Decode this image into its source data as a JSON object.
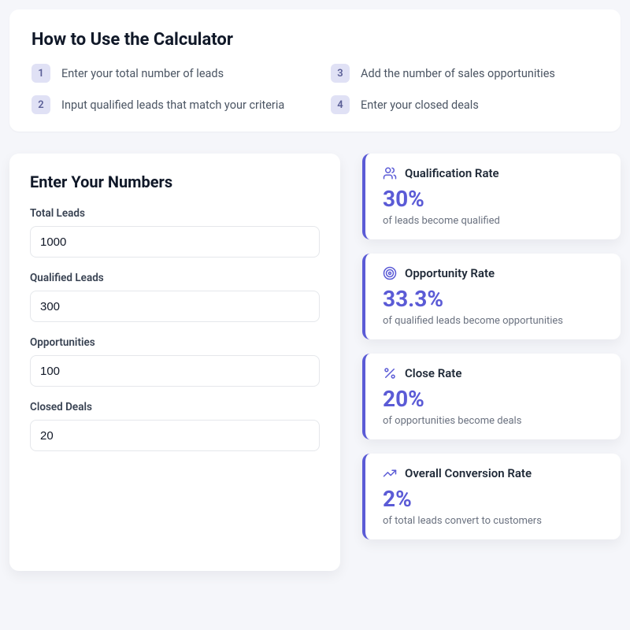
{
  "howto": {
    "title": "How to Use the Calculator",
    "steps": [
      {
        "num": "1",
        "text": "Enter your total number of leads"
      },
      {
        "num": "2",
        "text": "Input qualified leads that match your criteria"
      },
      {
        "num": "3",
        "text": "Add the number of sales opportunities"
      },
      {
        "num": "4",
        "text": "Enter your closed deals"
      }
    ]
  },
  "enter": {
    "title": "Enter Your Numbers",
    "fields": {
      "total_leads": {
        "label": "Total Leads",
        "value": "1000"
      },
      "qualified_leads": {
        "label": "Qualified Leads",
        "value": "300"
      },
      "opportunities": {
        "label": "Opportunities",
        "value": "100"
      },
      "closed_deals": {
        "label": "Closed Deals",
        "value": "20"
      }
    }
  },
  "metrics": {
    "qualification": {
      "title": "Qualification Rate",
      "value": "30%",
      "sub": "of leads become qualified"
    },
    "opportunity": {
      "title": "Opportunity Rate",
      "value": "33.3%",
      "sub": "of qualified leads become opportunities"
    },
    "close": {
      "title": "Close Rate",
      "value": "20%",
      "sub": "of opportunities become deals"
    },
    "overall": {
      "title": "Overall Conversion Rate",
      "value": "2%",
      "sub": "of total leads convert to customers"
    }
  }
}
